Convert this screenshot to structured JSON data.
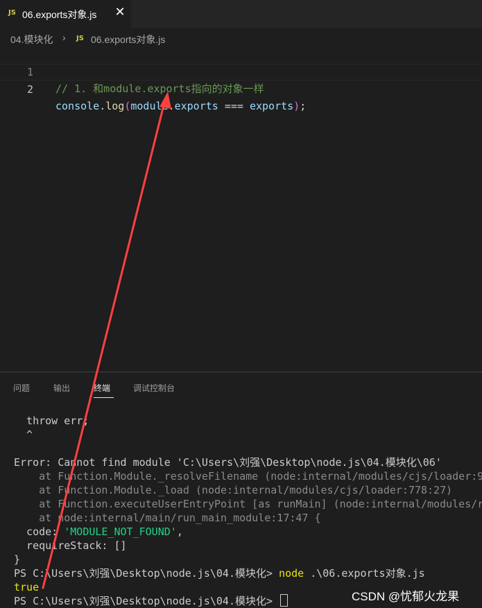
{
  "tab": {
    "badge": "JS",
    "title": "06.exports对象.js",
    "close_label": "✕"
  },
  "breadcrumb": {
    "folder": "04.模块化",
    "separator": "›",
    "badge": "JS",
    "file": "06.exports对象.js"
  },
  "editor": {
    "lines": [
      {
        "number": "1",
        "comment": "// 1. 和module.exports指向的对象一样"
      },
      {
        "number": "2",
        "tokens": [
          "console",
          ".",
          "log",
          "(",
          "module",
          ".",
          "exports",
          " === ",
          "exports",
          ")",
          ";"
        ]
      }
    ]
  },
  "panel": {
    "tabs": [
      "问题",
      "输出",
      "终端",
      "调试控制台"
    ],
    "active_tab": "终端"
  },
  "terminal": {
    "lines": [
      "  throw err;",
      "  ^",
      "",
      "Error: Cannot find module 'C:\\Users\\刘强\\Desktop\\node.js\\04.模块化\\06'",
      "    at Function.Module._resolveFilename (node:internal/modules/cjs/loader:9",
      "    at Function.Module._load (node:internal/modules/cjs/loader:778:27)",
      "    at Function.executeUserEntryPoint [as runMain] (node:internal/modules/r",
      "    at node:internal/main/run_main_module:17:47 {",
      "  code: ",
      "  requireStack: []",
      "}",
      "PS C:\\Users\\刘强\\Desktop\\node.js\\04.模块化> ",
      "true",
      "PS C:\\Users\\刘强\\Desktop\\node.js\\04.模块化> "
    ],
    "code_value": "'MODULE_NOT_FOUND'",
    "code_suffix": ",",
    "cmd_node": "node",
    "cmd_args": " .\\06.exports对象.js"
  },
  "watermark": "CSDN @忧郁火龙果",
  "colors": {
    "annotation_arrow": "#ff4040",
    "js_badge": "#cbcb41"
  }
}
